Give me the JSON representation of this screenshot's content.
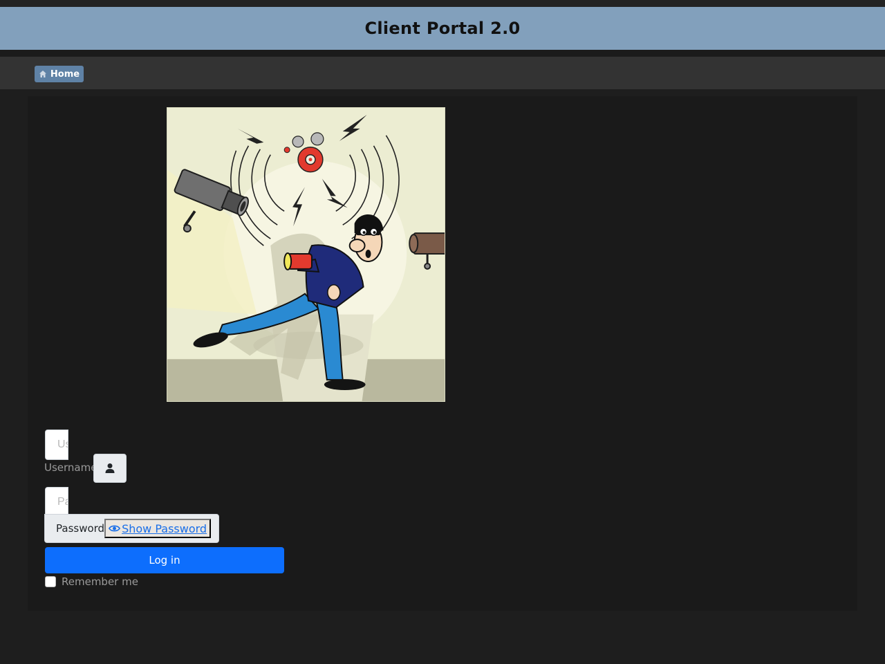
{
  "header": {
    "title": "Client Portal 2.0"
  },
  "nav": {
    "home_label": "Home",
    "home_icon": "home-icon"
  },
  "illustration": {
    "subject": "burglar-alarm-security-cameras"
  },
  "login": {
    "username_placeholder": "Username",
    "username_label": "Username",
    "username_icon": "user-icon",
    "password_placeholder": "Password",
    "password_label": "Password",
    "show_password_label": "Show Password",
    "show_password_icon": "eye-icon",
    "login_button": "Log in",
    "remember_label": "Remember me",
    "remember_checked": false
  },
  "colors": {
    "header_bg": "#82a0bc",
    "home_button": "#5f82a6",
    "primary": "#0d6efd",
    "page_bg": "#1e1e1e",
    "panel_bg": "#1a1a1a"
  }
}
